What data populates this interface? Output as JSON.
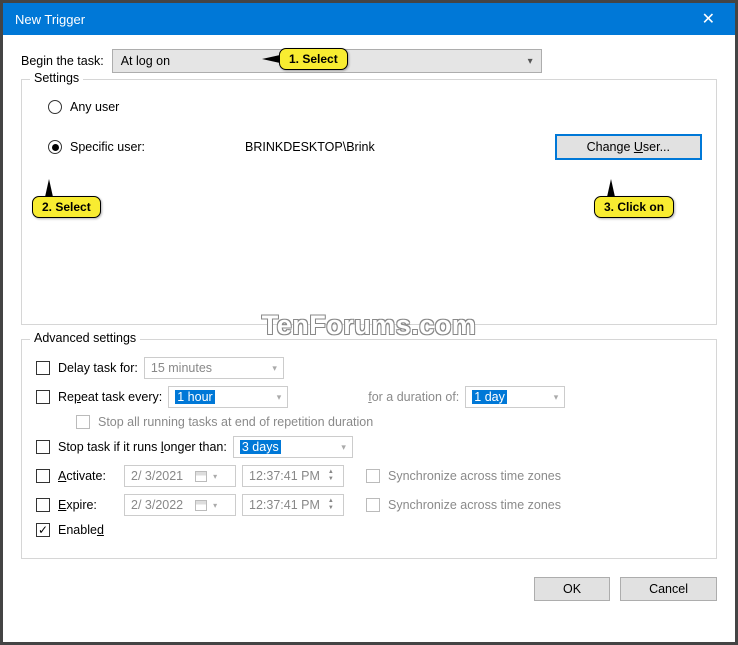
{
  "titlebar": {
    "title": "New Trigger",
    "close": "✕"
  },
  "begin": {
    "label": "Begin the task:",
    "value": "At log on"
  },
  "settings": {
    "legend": "Settings",
    "any_user": "Any user",
    "specific_user_label": "Specific user:",
    "specific_user_value": "BRINKDESKTOP\\Brink",
    "change_user_btn_pre": "Change ",
    "change_user_btn_u": "U",
    "change_user_btn_post": "ser..."
  },
  "callouts": {
    "c1": "1. Select",
    "c2": "2. Select",
    "c3": "3. Click on"
  },
  "advanced": {
    "legend": "Advanced settings",
    "delay_label": "Delay task for:",
    "delay_value": "15 minutes",
    "repeat_pre": "Re",
    "repeat_u": "p",
    "repeat_post": "eat task every:",
    "repeat_value": "1 hour",
    "duration_pre": "",
    "duration_u": "f",
    "duration_post": "or a duration of:",
    "duration_value": "1 day",
    "stop_all": "Stop all running tasks at end of repetition duration",
    "stop_if_pre": "Stop task if it runs ",
    "stop_if_u": "l",
    "stop_if_post": "onger than:",
    "stop_if_value": "3 days",
    "activate_u": "A",
    "activate_post": "ctivate:",
    "expire_u": "E",
    "expire_post": "xpire:",
    "date_activate": "2/  3/2021",
    "date_expire": "2/  3/2022",
    "time_value": "12:37:41 PM",
    "sync": "Synchronize across time zones",
    "enabled_pre": "Enable",
    "enabled_u": "d"
  },
  "buttons": {
    "ok": "OK",
    "cancel": "Cancel"
  },
  "watermark": "TenForums.com"
}
